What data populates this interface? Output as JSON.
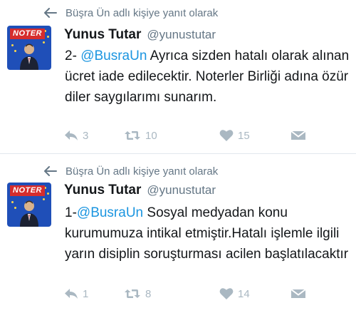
{
  "tweets": [
    {
      "reply_context": "Büşra Ün adlı kişiye yanıt olarak",
      "avatar_banner": "NOTER",
      "display_name": "Yunus Tutar",
      "handle": "@yunustutar",
      "text_prefix": "2- ",
      "mention": "@BusraUn",
      "text_rest": " Ayrıca sizden hatalı olarak alınan ücret iade edilecektir. Noterler Birliği adına özür diler saygılarımı sunarım.",
      "reply_count": "3",
      "retweet_count": "10",
      "like_count": "15"
    },
    {
      "reply_context": "Büşra Ün adlı kişiye yanıt olarak",
      "avatar_banner": "NOTER",
      "display_name": "Yunus Tutar",
      "handle": "@yunustutar",
      "text_prefix": "1-",
      "mention": "@BusraUn",
      "text_rest": " Sosyal medyadan konu kurumumuza intikal etmiştir.Hatalı işlemle ilgili yarın disiplin soruşturması acilen başlatılacaktır",
      "reply_count": "1",
      "retweet_count": "8",
      "like_count": "14"
    }
  ],
  "colors": {
    "text": "#14171a",
    "muted": "#657786",
    "icon": "#aab8c2",
    "link": "#1b95e0",
    "divider": "#e1e8ed",
    "avatar_bg": "#1f4fb8",
    "banner_red": "#d62d2d"
  },
  "icons": {
    "reply_context": "reply-arrow-icon",
    "reply": "reply-icon",
    "retweet": "retweet-icon",
    "like": "heart-icon",
    "dm": "envelope-icon"
  }
}
